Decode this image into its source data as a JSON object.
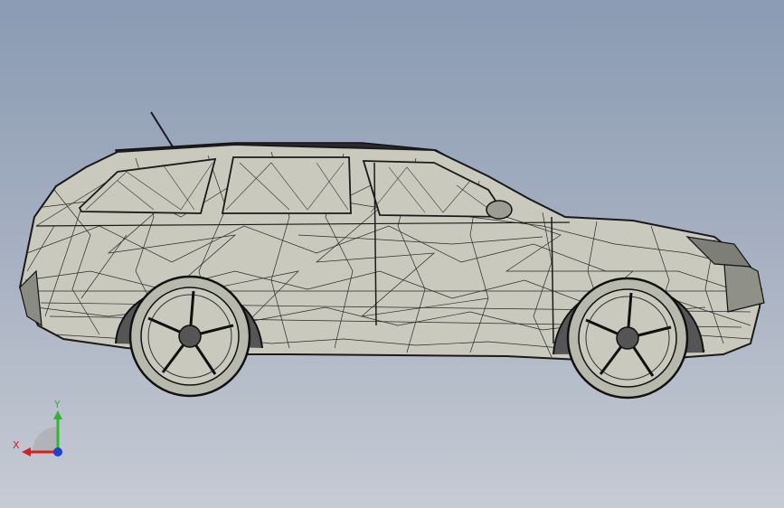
{
  "viewport": {
    "background_top": "#8a9bb3",
    "background_bottom": "#c6cbd4"
  },
  "model": {
    "face_color": "#c9cabd",
    "edge_color": "#1a1a1a"
  },
  "triad": {
    "x_label": "X",
    "y_label": "Y",
    "x_color": "#d42020",
    "y_color": "#2fb82f",
    "z_color": "#1f3fd0"
  }
}
